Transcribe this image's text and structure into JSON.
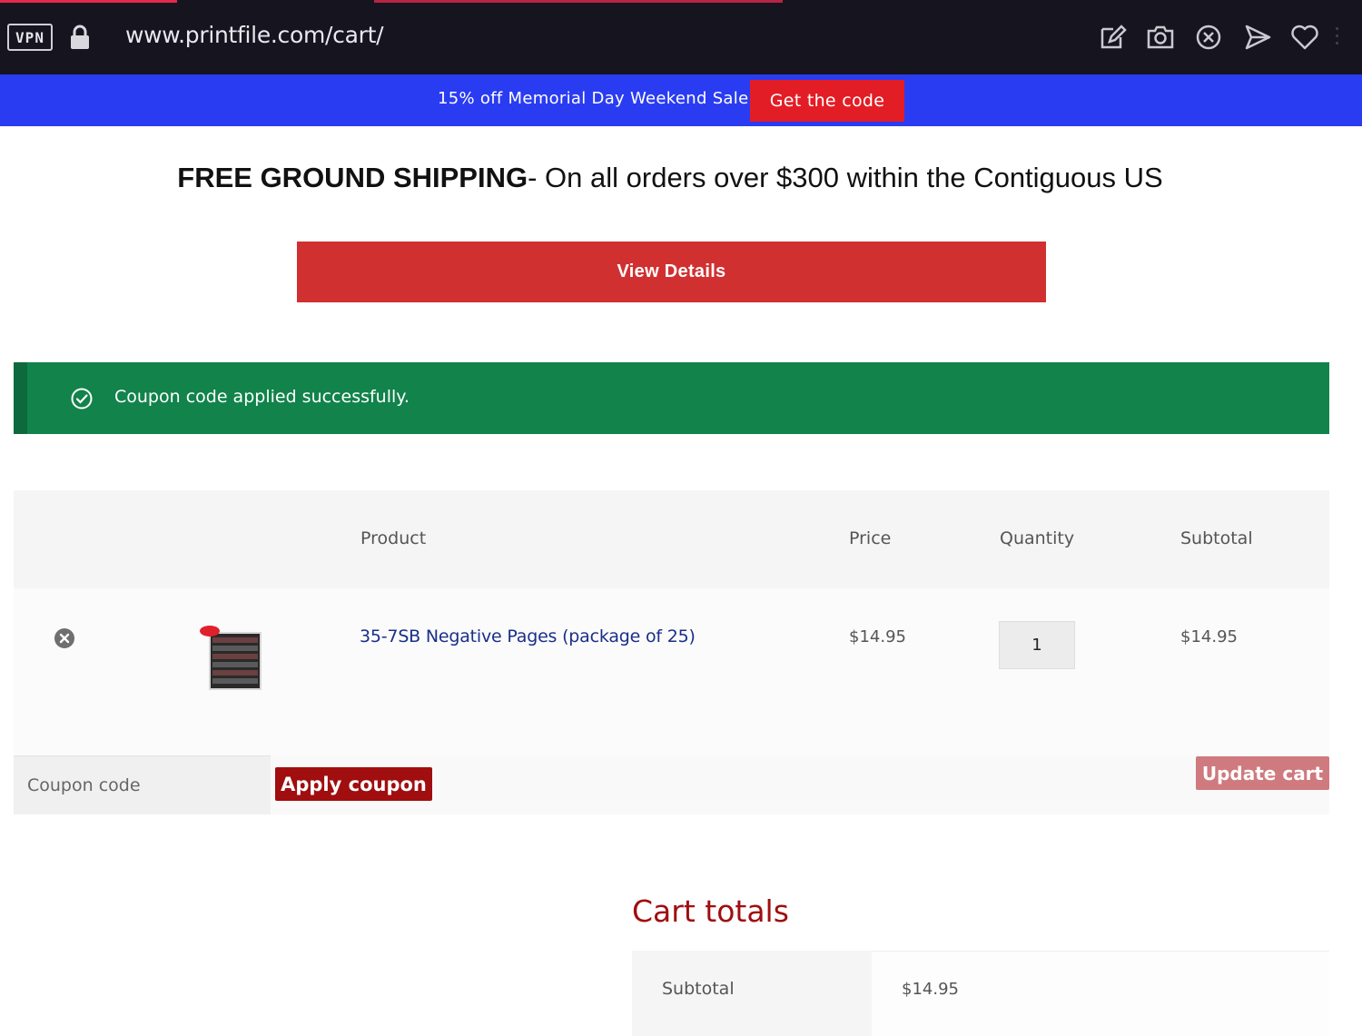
{
  "browser": {
    "vpn_label": "VPN",
    "url": "www.printfile.com/cart/"
  },
  "promo": {
    "text": "15% off Memorial Day Weekend Sale",
    "button_label": "Get the code"
  },
  "shipping": {
    "bold": "FREE GROUND SHIPPING",
    "rest": "- On all orders over $300 within the Contiguous US"
  },
  "view_details_label": "View Details",
  "notice": {
    "text": "Coupon code applied successfully."
  },
  "cart": {
    "columns": [
      "Product",
      "Price",
      "Quantity",
      "Subtotal"
    ],
    "items": [
      {
        "name": "35-7SB Negative Pages (package of 25)",
        "price": "$14.95",
        "quantity": "1",
        "subtotal": "$14.95"
      }
    ],
    "coupon_placeholder": "Coupon code",
    "apply_coupon_label": "Apply coupon",
    "update_cart_label": "Update cart"
  },
  "totals": {
    "title": "Cart totals",
    "subtotal_label": "Subtotal",
    "subtotal_value": "$14.95"
  },
  "colors": {
    "promo_bar": "#2a3cf2",
    "primary_red": "#d13030",
    "dark_red": "#a00e10",
    "success_green": "#11834b",
    "link_blue": "#1a2f8a"
  }
}
